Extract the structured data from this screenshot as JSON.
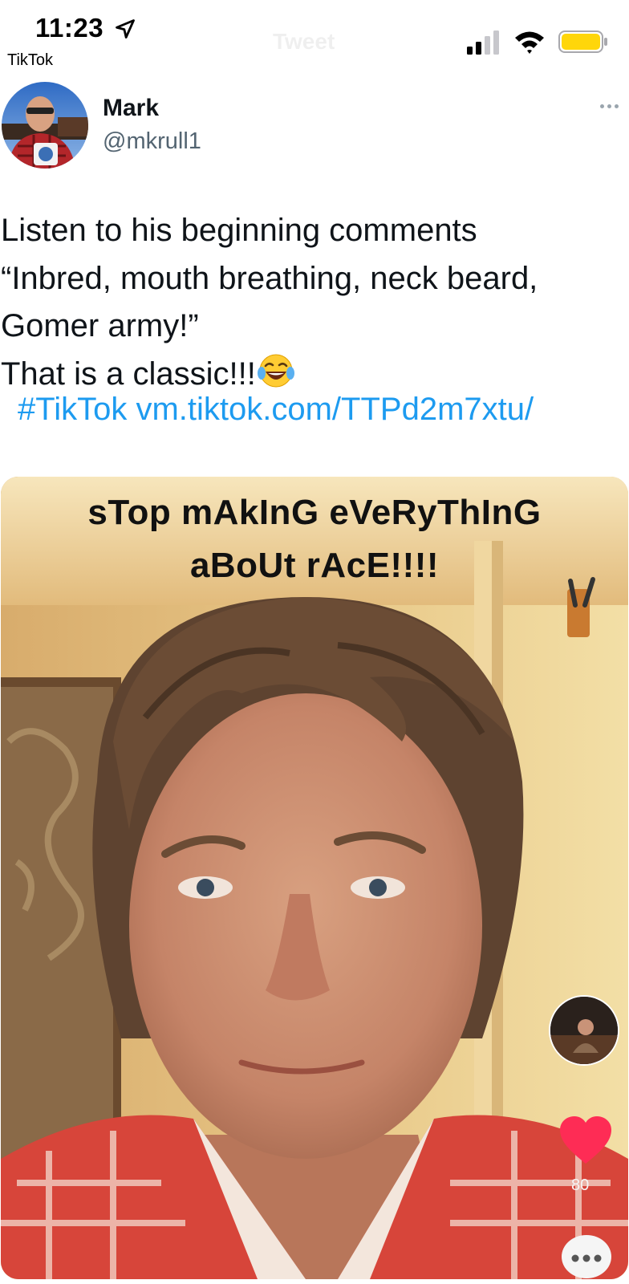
{
  "status_bar": {
    "time": "11:23",
    "back_app_label": "TikTok",
    "faded_title": "Tweet",
    "icons": [
      "location-arrow-icon",
      "cellular-signal-icon",
      "wifi-icon",
      "battery-icon"
    ],
    "battery_color": "#ffd60a"
  },
  "tweet": {
    "author": {
      "display_name": "Mark",
      "handle": "@mkrull1"
    },
    "text_lines": [
      "Listen to his beginning comments",
      "“Inbred, mouth breathing, neck beard,",
      "Gomer army!”",
      "That is a classic!!!"
    ],
    "emoji": "face-with-tears-of-joy-icon",
    "hashtag": "#TikTok",
    "link": "vm.tiktok.com/TTPd2m7xtu/",
    "link_color": "#1d9bf0"
  },
  "media": {
    "caption_line_1": "sTop mAkInG eVeRyThInG",
    "caption_line_2": "aBoUt rAcE!!!!",
    "like_count": "80",
    "like_color": "#fe2c55"
  }
}
